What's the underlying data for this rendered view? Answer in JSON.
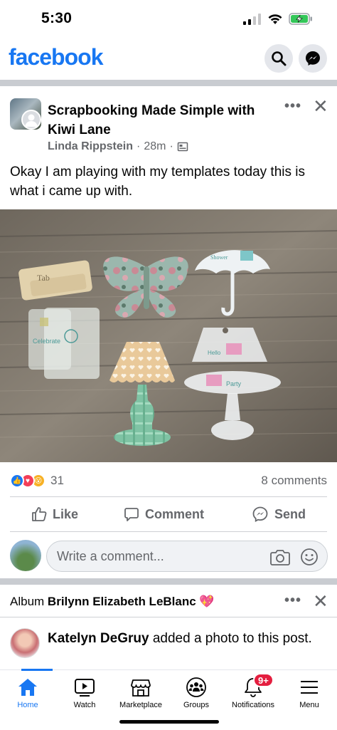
{
  "status_bar": {
    "time": "5:30"
  },
  "header": {
    "logo": "facebook",
    "search_icon": "search-icon",
    "messenger_icon": "messenger-icon"
  },
  "post": {
    "group_name": "Scrapbooking Made Simple with Kiwi Lane",
    "author": "Linda Rippstein",
    "separator": "·",
    "time": "28m",
    "text": "Okay I am playing with my templates today this is what i came up with.",
    "reaction_count": "31",
    "comments_label": "8 comments",
    "actions": {
      "like": "Like",
      "comment": "Comment",
      "send": "Send"
    },
    "comment_placeholder": "Write a comment...",
    "photo_labels": {
      "tab": "Tab",
      "celebrate": "Celebrate",
      "party": "Party",
      "hello": "Hello",
      "umbrella": "Shower"
    }
  },
  "next_post": {
    "album_prefix": "Album",
    "album_owner": "Brilynn Elizabeth LeBlanc",
    "album_emoji": "💖",
    "actor": "Katelyn DeGruy",
    "action_text": "added a photo to this post."
  },
  "nav": {
    "items": [
      {
        "label": "Home"
      },
      {
        "label": "Watch"
      },
      {
        "label": "Marketplace"
      },
      {
        "label": "Groups"
      },
      {
        "label": "Notifications"
      },
      {
        "label": "Menu"
      }
    ],
    "notifications_badge": "9+"
  },
  "colors": {
    "brand": "#1877f2",
    "muted": "#65676b",
    "badge": "#e41e3f",
    "divider": "#c9ccd1"
  }
}
